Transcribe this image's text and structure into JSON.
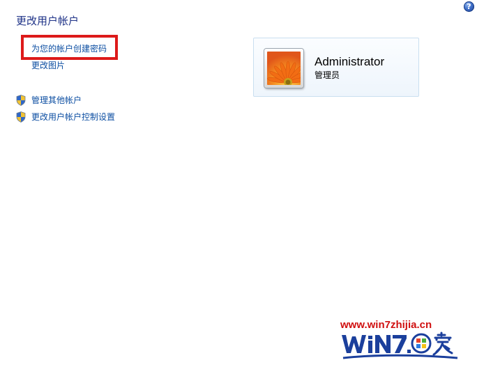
{
  "header": {
    "title": "更改用户帐户",
    "help_icon": "help-icon",
    "help_glyph": "?"
  },
  "tasks": {
    "create_password": "为您的帐户创建密码",
    "change_picture": "更改图片"
  },
  "related_tasks": [
    {
      "label": "管理其他帐户",
      "icon": "shield-icon"
    },
    {
      "label": "更改用户帐户控制设置",
      "icon": "shield-icon"
    }
  ],
  "account": {
    "name": "Administrator",
    "type": "管理员",
    "picture": "orange-flower-avatar"
  },
  "watermark": {
    "url": "www.win7zhijia.cn",
    "logo": "Win7之家"
  },
  "colors": {
    "title": "#1e3287",
    "link": "#0c4ea2",
    "highlight": "#dd1a1a",
    "card_border": "#c9dff0",
    "watermark_red": "#d01010",
    "watermark_blue": "#1b3f9c"
  }
}
